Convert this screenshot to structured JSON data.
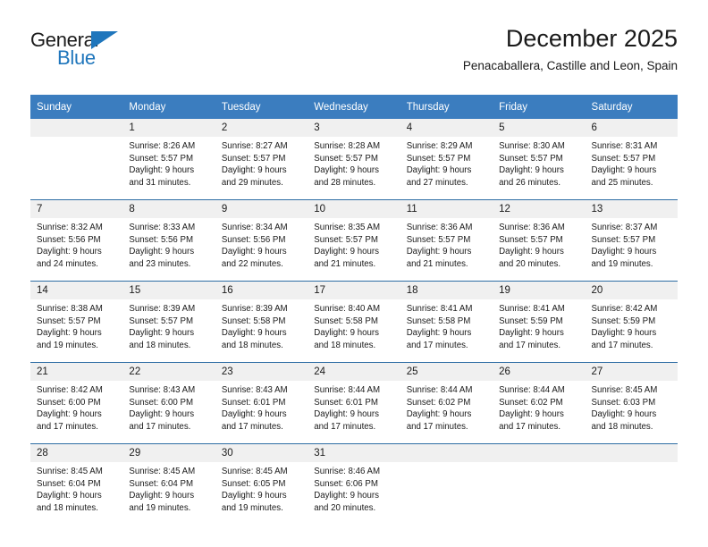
{
  "brand": {
    "name_part1": "General",
    "name_part2": "Blue",
    "accent_color": "#1f76bc"
  },
  "header": {
    "title": "December 2025",
    "subtitle": "Penacaballera, Castille and Leon, Spain"
  },
  "calendar": {
    "header_bg": "#3b7dbf",
    "daynum_bg": "#f0f0f0",
    "weekday_headers": [
      "Sunday",
      "Monday",
      "Tuesday",
      "Wednesday",
      "Thursday",
      "Friday",
      "Saturday"
    ],
    "weeks": [
      [
        {
          "day": "",
          "sunrise": "",
          "sunset": "",
          "daylight_line1": "",
          "daylight_line2": ""
        },
        {
          "day": "1",
          "sunrise": "Sunrise: 8:26 AM",
          "sunset": "Sunset: 5:57 PM",
          "daylight_line1": "Daylight: 9 hours",
          "daylight_line2": "and 31 minutes."
        },
        {
          "day": "2",
          "sunrise": "Sunrise: 8:27 AM",
          "sunset": "Sunset: 5:57 PM",
          "daylight_line1": "Daylight: 9 hours",
          "daylight_line2": "and 29 minutes."
        },
        {
          "day": "3",
          "sunrise": "Sunrise: 8:28 AM",
          "sunset": "Sunset: 5:57 PM",
          "daylight_line1": "Daylight: 9 hours",
          "daylight_line2": "and 28 minutes."
        },
        {
          "day": "4",
          "sunrise": "Sunrise: 8:29 AM",
          "sunset": "Sunset: 5:57 PM",
          "daylight_line1": "Daylight: 9 hours",
          "daylight_line2": "and 27 minutes."
        },
        {
          "day": "5",
          "sunrise": "Sunrise: 8:30 AM",
          "sunset": "Sunset: 5:57 PM",
          "daylight_line1": "Daylight: 9 hours",
          "daylight_line2": "and 26 minutes."
        },
        {
          "day": "6",
          "sunrise": "Sunrise: 8:31 AM",
          "sunset": "Sunset: 5:57 PM",
          "daylight_line1": "Daylight: 9 hours",
          "daylight_line2": "and 25 minutes."
        }
      ],
      [
        {
          "day": "7",
          "sunrise": "Sunrise: 8:32 AM",
          "sunset": "Sunset: 5:56 PM",
          "daylight_line1": "Daylight: 9 hours",
          "daylight_line2": "and 24 minutes."
        },
        {
          "day": "8",
          "sunrise": "Sunrise: 8:33 AM",
          "sunset": "Sunset: 5:56 PM",
          "daylight_line1": "Daylight: 9 hours",
          "daylight_line2": "and 23 minutes."
        },
        {
          "day": "9",
          "sunrise": "Sunrise: 8:34 AM",
          "sunset": "Sunset: 5:56 PM",
          "daylight_line1": "Daylight: 9 hours",
          "daylight_line2": "and 22 minutes."
        },
        {
          "day": "10",
          "sunrise": "Sunrise: 8:35 AM",
          "sunset": "Sunset: 5:57 PM",
          "daylight_line1": "Daylight: 9 hours",
          "daylight_line2": "and 21 minutes."
        },
        {
          "day": "11",
          "sunrise": "Sunrise: 8:36 AM",
          "sunset": "Sunset: 5:57 PM",
          "daylight_line1": "Daylight: 9 hours",
          "daylight_line2": "and 21 minutes."
        },
        {
          "day": "12",
          "sunrise": "Sunrise: 8:36 AM",
          "sunset": "Sunset: 5:57 PM",
          "daylight_line1": "Daylight: 9 hours",
          "daylight_line2": "and 20 minutes."
        },
        {
          "day": "13",
          "sunrise": "Sunrise: 8:37 AM",
          "sunset": "Sunset: 5:57 PM",
          "daylight_line1": "Daylight: 9 hours",
          "daylight_line2": "and 19 minutes."
        }
      ],
      [
        {
          "day": "14",
          "sunrise": "Sunrise: 8:38 AM",
          "sunset": "Sunset: 5:57 PM",
          "daylight_line1": "Daylight: 9 hours",
          "daylight_line2": "and 19 minutes."
        },
        {
          "day": "15",
          "sunrise": "Sunrise: 8:39 AM",
          "sunset": "Sunset: 5:57 PM",
          "daylight_line1": "Daylight: 9 hours",
          "daylight_line2": "and 18 minutes."
        },
        {
          "day": "16",
          "sunrise": "Sunrise: 8:39 AM",
          "sunset": "Sunset: 5:58 PM",
          "daylight_line1": "Daylight: 9 hours",
          "daylight_line2": "and 18 minutes."
        },
        {
          "day": "17",
          "sunrise": "Sunrise: 8:40 AM",
          "sunset": "Sunset: 5:58 PM",
          "daylight_line1": "Daylight: 9 hours",
          "daylight_line2": "and 18 minutes."
        },
        {
          "day": "18",
          "sunrise": "Sunrise: 8:41 AM",
          "sunset": "Sunset: 5:58 PM",
          "daylight_line1": "Daylight: 9 hours",
          "daylight_line2": "and 17 minutes."
        },
        {
          "day": "19",
          "sunrise": "Sunrise: 8:41 AM",
          "sunset": "Sunset: 5:59 PM",
          "daylight_line1": "Daylight: 9 hours",
          "daylight_line2": "and 17 minutes."
        },
        {
          "day": "20",
          "sunrise": "Sunrise: 8:42 AM",
          "sunset": "Sunset: 5:59 PM",
          "daylight_line1": "Daylight: 9 hours",
          "daylight_line2": "and 17 minutes."
        }
      ],
      [
        {
          "day": "21",
          "sunrise": "Sunrise: 8:42 AM",
          "sunset": "Sunset: 6:00 PM",
          "daylight_line1": "Daylight: 9 hours",
          "daylight_line2": "and 17 minutes."
        },
        {
          "day": "22",
          "sunrise": "Sunrise: 8:43 AM",
          "sunset": "Sunset: 6:00 PM",
          "daylight_line1": "Daylight: 9 hours",
          "daylight_line2": "and 17 minutes."
        },
        {
          "day": "23",
          "sunrise": "Sunrise: 8:43 AM",
          "sunset": "Sunset: 6:01 PM",
          "daylight_line1": "Daylight: 9 hours",
          "daylight_line2": "and 17 minutes."
        },
        {
          "day": "24",
          "sunrise": "Sunrise: 8:44 AM",
          "sunset": "Sunset: 6:01 PM",
          "daylight_line1": "Daylight: 9 hours",
          "daylight_line2": "and 17 minutes."
        },
        {
          "day": "25",
          "sunrise": "Sunrise: 8:44 AM",
          "sunset": "Sunset: 6:02 PM",
          "daylight_line1": "Daylight: 9 hours",
          "daylight_line2": "and 17 minutes."
        },
        {
          "day": "26",
          "sunrise": "Sunrise: 8:44 AM",
          "sunset": "Sunset: 6:02 PM",
          "daylight_line1": "Daylight: 9 hours",
          "daylight_line2": "and 17 minutes."
        },
        {
          "day": "27",
          "sunrise": "Sunrise: 8:45 AM",
          "sunset": "Sunset: 6:03 PM",
          "daylight_line1": "Daylight: 9 hours",
          "daylight_line2": "and 18 minutes."
        }
      ],
      [
        {
          "day": "28",
          "sunrise": "Sunrise: 8:45 AM",
          "sunset": "Sunset: 6:04 PM",
          "daylight_line1": "Daylight: 9 hours",
          "daylight_line2": "and 18 minutes."
        },
        {
          "day": "29",
          "sunrise": "Sunrise: 8:45 AM",
          "sunset": "Sunset: 6:04 PM",
          "daylight_line1": "Daylight: 9 hours",
          "daylight_line2": "and 19 minutes."
        },
        {
          "day": "30",
          "sunrise": "Sunrise: 8:45 AM",
          "sunset": "Sunset: 6:05 PM",
          "daylight_line1": "Daylight: 9 hours",
          "daylight_line2": "and 19 minutes."
        },
        {
          "day": "31",
          "sunrise": "Sunrise: 8:46 AM",
          "sunset": "Sunset: 6:06 PM",
          "daylight_line1": "Daylight: 9 hours",
          "daylight_line2": "and 20 minutes."
        },
        {
          "day": "",
          "sunrise": "",
          "sunset": "",
          "daylight_line1": "",
          "daylight_line2": ""
        },
        {
          "day": "",
          "sunrise": "",
          "sunset": "",
          "daylight_line1": "",
          "daylight_line2": ""
        },
        {
          "day": "",
          "sunrise": "",
          "sunset": "",
          "daylight_line1": "",
          "daylight_line2": ""
        }
      ]
    ]
  }
}
